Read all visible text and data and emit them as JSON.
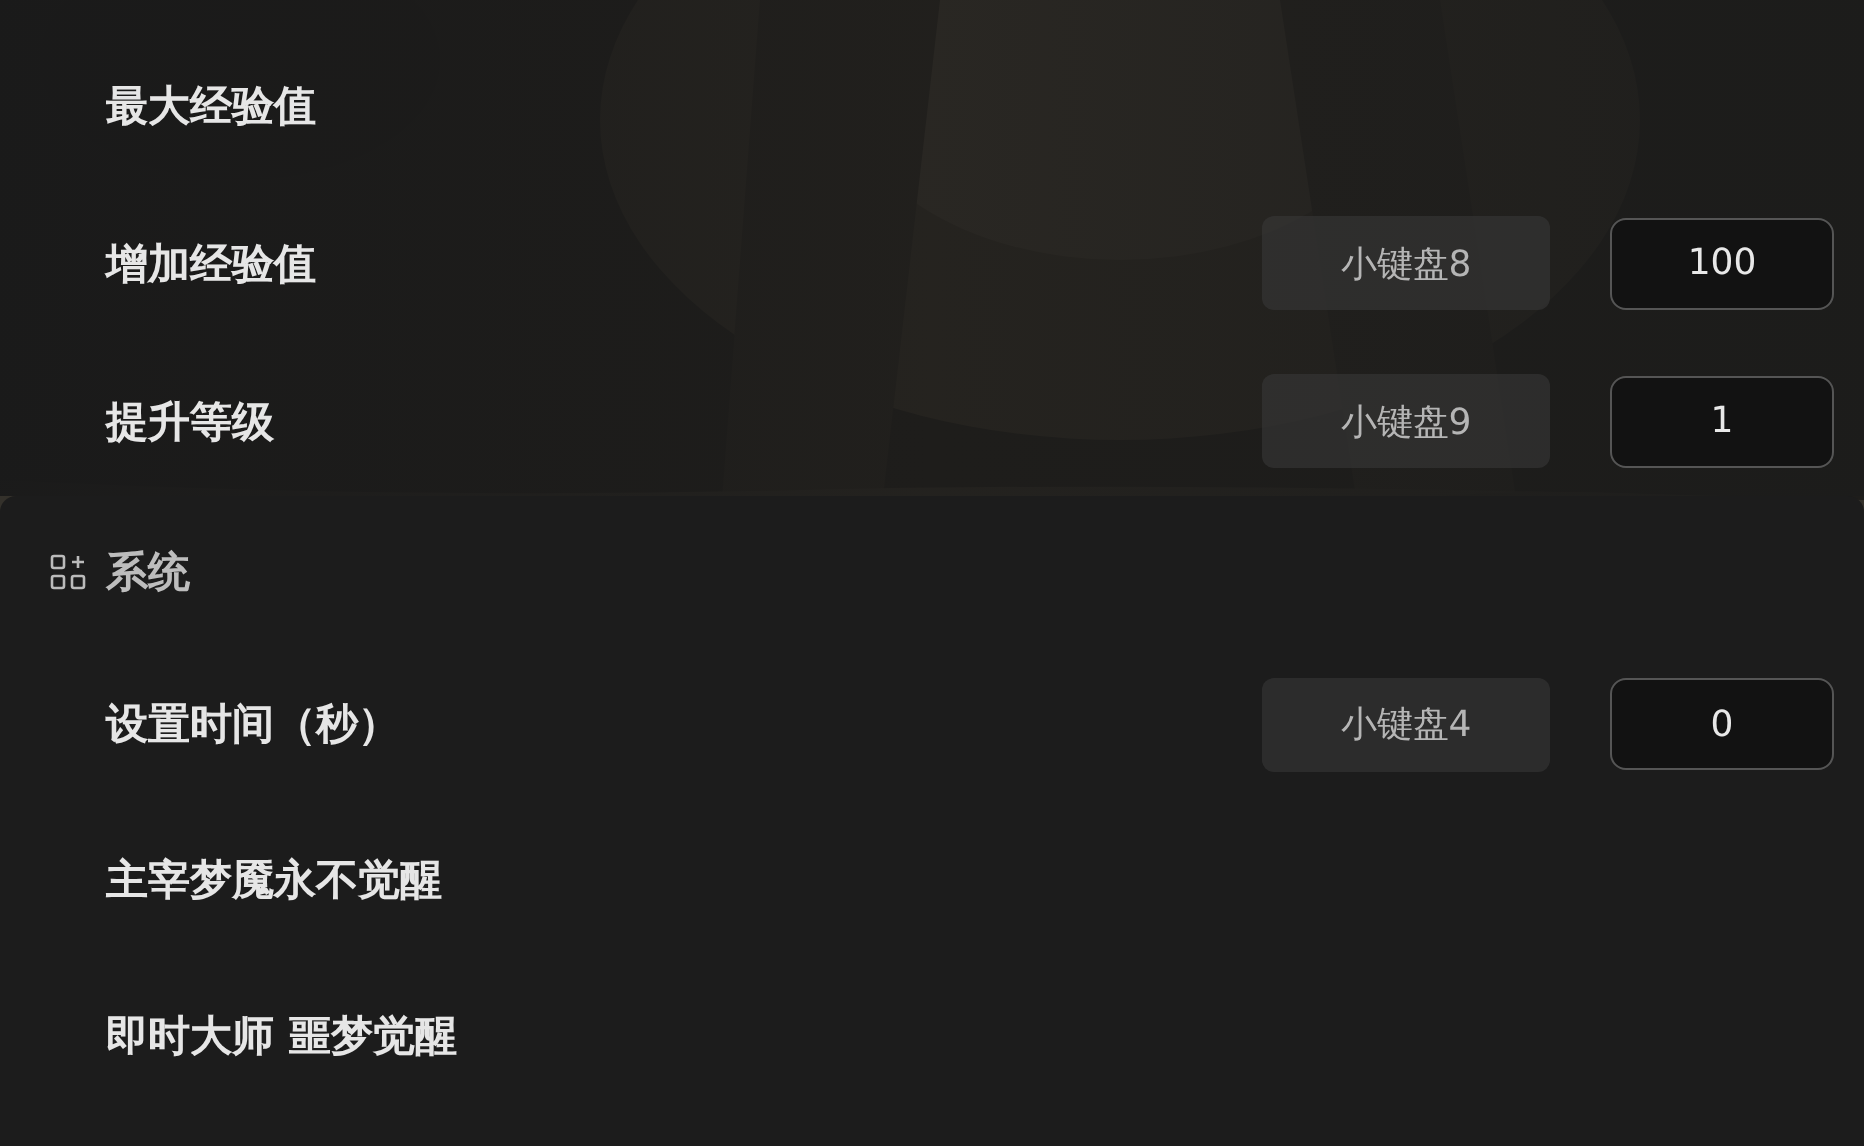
{
  "top_rows": [
    {
      "label": "最大经验值"
    },
    {
      "label": "增加经验值",
      "hotkey": "小键盘8",
      "value": "100"
    },
    {
      "label": "提升等级",
      "hotkey": "小键盘9",
      "value": "1"
    }
  ],
  "section": {
    "title": "系统",
    "rows": [
      {
        "label": "设置时间（秒）",
        "hotkey": "小键盘4",
        "value": "0"
      },
      {
        "label": "主宰梦魇永不觉醒"
      },
      {
        "label": "即时大师 噩梦觉醒"
      }
    ]
  }
}
